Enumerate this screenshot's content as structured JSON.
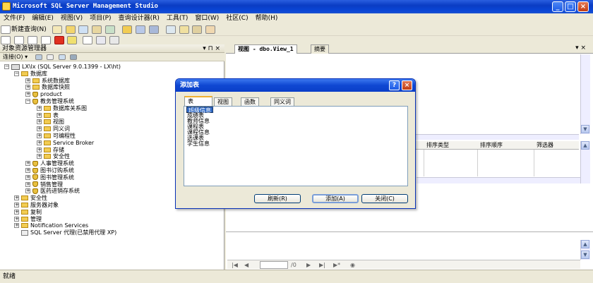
{
  "window": {
    "title": "Microsoft SQL Server Management Studio",
    "min": "_",
    "max": "□",
    "close": "×"
  },
  "menu": [
    "文件(F)",
    "编辑(E)",
    "视图(V)",
    "项目(P)",
    "查询设计器(R)",
    "工具(T)",
    "窗口(W)",
    "社区(C)",
    "帮助(H)"
  ],
  "toolbar": {
    "new_query": "新建查询(N)"
  },
  "explorer": {
    "title": "对象资源管理器",
    "pin": "▾ ⊓ ×",
    "connect": "连接(O) ▾",
    "nodes": [
      {
        "pm": "−",
        "icon": "server",
        "label": "LX\\lx (SQL Server 9.0.1399 - LX\\ht)"
      },
      {
        "pm": "−",
        "icon": "folder",
        "label": "数据库"
      },
      {
        "pm": "+",
        "icon": "folder",
        "label": "系统数据库"
      },
      {
        "pm": "+",
        "icon": "folder",
        "label": "数据库快照"
      },
      {
        "pm": "+",
        "icon": "db",
        "label": "product"
      },
      {
        "pm": "−",
        "icon": "db",
        "label": "教务管理系统"
      },
      {
        "pm": "+",
        "icon": "folder",
        "label": "数据库关系图"
      },
      {
        "pm": "+",
        "icon": "folder",
        "label": "表"
      },
      {
        "pm": "+",
        "icon": "folder",
        "label": "视图"
      },
      {
        "pm": "+",
        "icon": "folder",
        "label": "同义词"
      },
      {
        "pm": "+",
        "icon": "folder",
        "label": "可编程性"
      },
      {
        "pm": "+",
        "icon": "folder",
        "label": "Service Broker"
      },
      {
        "pm": "+",
        "icon": "folder",
        "label": "存储"
      },
      {
        "pm": "+",
        "icon": "folder",
        "label": "安全性"
      },
      {
        "pm": "+",
        "icon": "db",
        "label": "人事管理系统"
      },
      {
        "pm": "+",
        "icon": "db",
        "label": "图书订购系统"
      },
      {
        "pm": "+",
        "icon": "db",
        "label": "图书管理系统"
      },
      {
        "pm": "+",
        "icon": "db",
        "label": "销售管理"
      },
      {
        "pm": "+",
        "icon": "db",
        "label": "医药进销存系统"
      },
      {
        "pm": "+",
        "icon": "folder",
        "label": "安全性"
      },
      {
        "pm": "+",
        "icon": "folder",
        "label": "服务器对象"
      },
      {
        "pm": "+",
        "icon": "folder",
        "label": "复制"
      },
      {
        "pm": "+",
        "icon": "folder",
        "label": "管理"
      },
      {
        "pm": "+",
        "icon": "folder",
        "label": "Notification Services"
      },
      {
        "pm": "",
        "icon": "agent",
        "label": "SQL Server 代理(已禁用代理 XP)"
      }
    ]
  },
  "doc_tabs": [
    "视图 - dbo.View_1",
    "摘要"
  ],
  "grid_headers": [
    "排序类型",
    "排序顺序",
    "筛选器"
  ],
  "nav": {
    "record": "",
    "of": "/0"
  },
  "dialog": {
    "title": "添加表",
    "help": "?",
    "close": "×",
    "tabs": [
      "表",
      "视图",
      "函数",
      "同义词"
    ],
    "items": [
      "班级信息",
      "成绩表",
      "教师信息",
      "课程表",
      "课程信息",
      "选课表",
      "学生信息"
    ],
    "refresh": "刷新(R)",
    "add": "添加(A)",
    "close_btn": "关闭(C)"
  },
  "status": "就绪"
}
